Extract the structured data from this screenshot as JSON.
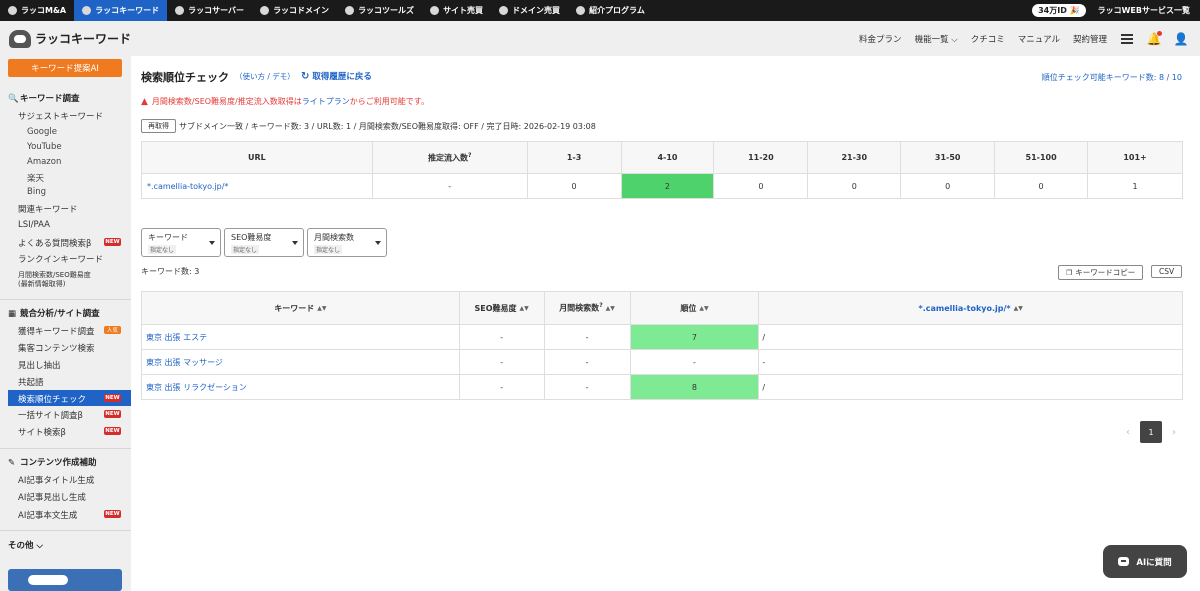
{
  "topbar": {
    "items": [
      {
        "label": "ラッコM&A",
        "icon": "m-and-a-icon"
      },
      {
        "label": "ラッコキーワード",
        "icon": "keyword-icon"
      },
      {
        "label": "ラッコサーバー",
        "icon": "server-icon"
      },
      {
        "label": "ラッコドメイン",
        "icon": "domain-icon"
      },
      {
        "label": "ラッコツールズ",
        "icon": "tools-icon"
      },
      {
        "label": "サイト売買",
        "icon": "site-sale-icon"
      },
      {
        "label": "ドメイン売買",
        "icon": "domain-sale-icon"
      },
      {
        "label": "紹介プログラム",
        "icon": "referral-icon"
      }
    ],
    "badge": "34万ID 🎉",
    "services": "ラッコWEBサービス一覧"
  },
  "header": {
    "logo_text": "ラッコキーワード",
    "nav": {
      "pricing": "料金プラン",
      "features": "機能一覧 ⌵",
      "reviews": "クチコミ",
      "manual": "マニュアル",
      "contract": "契約管理"
    }
  },
  "sidebar": {
    "cta": "キーワード提案AI",
    "sections": {
      "keyword_research": "キーワード調査",
      "competitor": "競合分析/サイト調査",
      "content": "コンテンツ作成補助",
      "other": "その他 ⌵"
    },
    "items": {
      "suggest": "サジェストキーワード",
      "google": "Google",
      "youtube": "YouTube",
      "amazon": "Amazon",
      "rakuten": "楽天",
      "bing": "Bing",
      "related": "関連キーワード",
      "lsi": "LSI/PAA",
      "faq": "よくある質問検索β",
      "rankin": "ランクインキーワード",
      "volume_line1": "月間検索数/SEO難易度",
      "volume_line2": "(最新情報取得)",
      "acquired": "獲得キーワード調査",
      "traffic": "集客コンテンツ検索",
      "headings": "見出し抽出",
      "cooccur": "共起語",
      "rank_check": "検索順位チェック",
      "bulk": "一括サイト調査β",
      "site_search": "サイト検索β",
      "ai_title": "AI記事タイトル生成",
      "ai_heading": "AI記事見出し生成",
      "ai_body": "AI記事本文生成"
    },
    "badges": {
      "new": "NEW",
      "popular": "人気"
    }
  },
  "main": {
    "title": "検索順位チェック",
    "howto": "（使い方 / デモ）",
    "back_link": "取得履歴に戻る",
    "kw_limit": "順位チェック可能キーワード数: 8 / 10",
    "warning": {
      "prefix": "月間検索数/SEO難易度/推定流入数取得は",
      "link": "ライトプラン",
      "suffix": "からご利用可能です。"
    },
    "refetch_button": "再取得",
    "fetch_info": "サブドメイン一致 / キーワード数: 3 / URL数: 1 / 月間検索数/SEO難易度取得: OFF / 完了日時: 2026-02-19 03:08",
    "summary_table": {
      "headers": [
        "URL",
        "推定流入数",
        "1-3",
        "4-10",
        "11-20",
        "21-30",
        "31-50",
        "51-100",
        "101+"
      ],
      "row": {
        "url": "*.camellia-tokyo.jp/*",
        "traffic": "-",
        "r1_3": "0",
        "r4_10": "2",
        "r11_20": "0",
        "r21_30": "0",
        "r31_50": "0",
        "r51_100": "0",
        "r101": "1"
      }
    },
    "filters": [
      {
        "label": "キーワード",
        "sub": "指定なし"
      },
      {
        "label": "SEO難易度",
        "sub": "指定なし"
      },
      {
        "label": "月間検索数",
        "sub": "指定なし"
      }
    ],
    "kw_count": "キーワード数: 3",
    "copy_button": "キーワードコピー",
    "csv_button": "CSV",
    "rank_table": {
      "headers": [
        "キーワード",
        "SEO難易度",
        "月間検索数",
        "順位",
        "*.camellia-tokyo.jp/*"
      ],
      "rows": [
        {
          "keyword": "東京 出張 エステ",
          "seo": "-",
          "volume": "-",
          "rank": "7",
          "url": "/"
        },
        {
          "keyword": "東京 出張 マッサージ",
          "seo": "-",
          "volume": "-",
          "rank": "-",
          "url": "-"
        },
        {
          "keyword": "東京 出張 リラクゼーション",
          "seo": "-",
          "volume": "-",
          "rank": "8",
          "url": "/"
        }
      ]
    },
    "pager": {
      "current": "1",
      "prev": "‹",
      "next": "›"
    },
    "ai_button": "AIに質問"
  },
  "colors": {
    "accent": "#1f63c6",
    "cta": "#f07a1f",
    "new_badge": "#d42b2b",
    "rank_highlight": "#4ed26c",
    "rank_light": "#7eea94"
  }
}
